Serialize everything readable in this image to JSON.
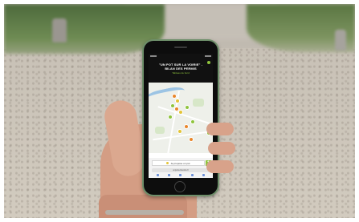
{
  "app": {
    "title": "\"UN POT SUR LA VOIRIE\" - BILAN DES PERMIS",
    "subtitle": "Tableau de bord",
    "cta_label": "Je propose un pot",
    "url_text": "unpotsurlavoirie.fr"
  },
  "colors": {
    "accent_green": "#8fc43d",
    "marker_orange": "#e9862a",
    "marker_yellow": "#e3c437",
    "phone_case": "#6e8f6a"
  }
}
